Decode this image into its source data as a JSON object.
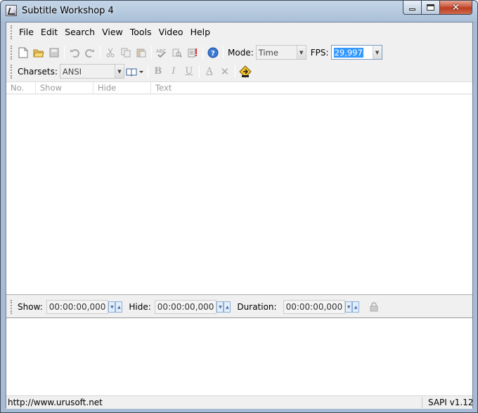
{
  "window": {
    "title": "Subtitle Workshop 4",
    "close_glyph": "✕",
    "colors": {
      "frame": "#a7bcd4",
      "client": "#f0f0f0",
      "selection": "#3399ff"
    }
  },
  "menu": [
    "File",
    "Edit",
    "Search",
    "View",
    "Tools",
    "Video",
    "Help"
  ],
  "toolbar1": {
    "icons": {
      "new": "new-file-icon",
      "open": "open-folder-icon",
      "save": "save-icon",
      "undo": "undo-icon",
      "redo": "redo-icon",
      "cut": "cut-icon",
      "copy": "copy-icon",
      "paste": "paste-icon",
      "spell": "spell-check-icon",
      "search": "search-icon",
      "replace": "replace-icon",
      "help": "help-icon"
    },
    "mode_label": "Mode:",
    "mode_value": "Time",
    "fps_label": "FPS:",
    "fps_value": "29,997"
  },
  "toolbar2": {
    "charsets_label": "Charsets:",
    "charsets_value": "ANSI",
    "bold": "B",
    "italic": "I",
    "underline": "U",
    "font_color": "A",
    "clear": "✕",
    "icons": {
      "dictionary": "dictionary-icon",
      "translator": "translator-icon"
    }
  },
  "list": {
    "columns": [
      "No.",
      "Show",
      "Hide",
      "Text"
    ]
  },
  "timing": {
    "show_label": "Show:",
    "show_value": "00:00:00,000",
    "hide_label": "Hide:",
    "hide_value": "00:00:00,000",
    "duration_label": "Duration:",
    "duration_value": "00:00:00,000",
    "spin_down": "▼",
    "spin_up": "▲"
  },
  "status": {
    "url": "http://www.urusoft.net",
    "version": "SAPI v1.12"
  }
}
